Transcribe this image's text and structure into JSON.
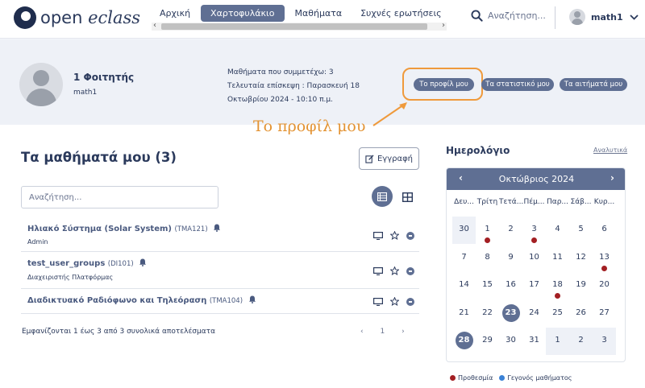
{
  "brand": {
    "name_part1": "open ",
    "name_part2": "eclass"
  },
  "nav": {
    "items": [
      "Αρχική",
      "Χαρτοφυλάκιο",
      "Μαθήματα",
      "Συχνές ερωτήσεις"
    ],
    "active_index": 1,
    "scroll_left": "‹",
    "scroll_right": "›"
  },
  "search": {
    "placeholder": "Αναζήτηση..."
  },
  "user": {
    "name": "math1"
  },
  "profile": {
    "role": "1 Φοιτητής",
    "username": "math1",
    "info_courses": "Μαθήματα που συμμετέχω: 3",
    "info_last_visit_1": "Τελευταία επίσκεψη : Παρασκευή 18",
    "info_last_visit_2": "Οκτωβρίου 2024 - 10:10 π.μ.",
    "buttons": [
      "Το προφίλ μου",
      "Τα στατιστικό μου",
      "Τα αιτήματά μου"
    ]
  },
  "annotation": {
    "text": "Το προφίλ μου",
    "color": "#e39333"
  },
  "courses": {
    "title": "Τα μαθήματά μου  (3)",
    "enroll_label": "Εγγραφή",
    "search_placeholder": "Αναζήτηση...",
    "items": [
      {
        "title": "Ηλιακό Σύστημα (Solar System)",
        "code": "(TMA121)",
        "sub": "Admin"
      },
      {
        "title": "test_user_groups",
        "code": "(DI101)",
        "sub": "Διαχειριστής Πλατφόρμας"
      },
      {
        "title": "Διαδικτυακό Ραδιόφωνο και Τηλεόραση",
        "code": "(TMA104)",
        "sub": ""
      }
    ],
    "results_text": "Εμφανίζονται 1 έως 3 από 3 συνολικά αποτελέσματα",
    "pager": {
      "prev": "‹",
      "page": "1",
      "next": "›"
    }
  },
  "calendar": {
    "title": "Ημερολόγιο",
    "detail_link": "Αναλυτικά",
    "month": "Οκτώβριος 2024",
    "prev": "‹",
    "next": "›",
    "weekdays": [
      "Δευ...",
      "Τρίτη",
      "Τετά...",
      "Πέμ...",
      "Παρ...",
      "Σάβ...",
      "Κυρ..."
    ],
    "weeks": [
      [
        "30",
        "1",
        "2",
        "3",
        "4",
        "5",
        "6"
      ],
      [
        "7",
        "8",
        "9",
        "10",
        "11",
        "12",
        "13"
      ],
      [
        "14",
        "15",
        "16",
        "17",
        "18",
        "19",
        "20"
      ],
      [
        "21",
        "22",
        "23",
        "24",
        "25",
        "26",
        "27"
      ],
      [
        "28",
        "29",
        "30",
        "31",
        "1",
        "2",
        "3"
      ]
    ],
    "muted_days": [
      "0-0",
      "4-4",
      "4-5",
      "4-6"
    ],
    "event_days": [
      "0-1",
      "0-3",
      "1-6",
      "2-4"
    ],
    "selected_days": [
      "3-2",
      "4-0"
    ],
    "legend": [
      {
        "label": "Προθεσμία",
        "color": "#a31f23"
      },
      {
        "label": "Γεγονός μαθήματος",
        "color": "#3b82d6"
      }
    ]
  },
  "colors": {
    "primary": "#5f6f93",
    "text": "#2b3a5c",
    "deadline": "#a31f23",
    "event": "#3b82d6",
    "annotation": "#ef9a3c"
  }
}
